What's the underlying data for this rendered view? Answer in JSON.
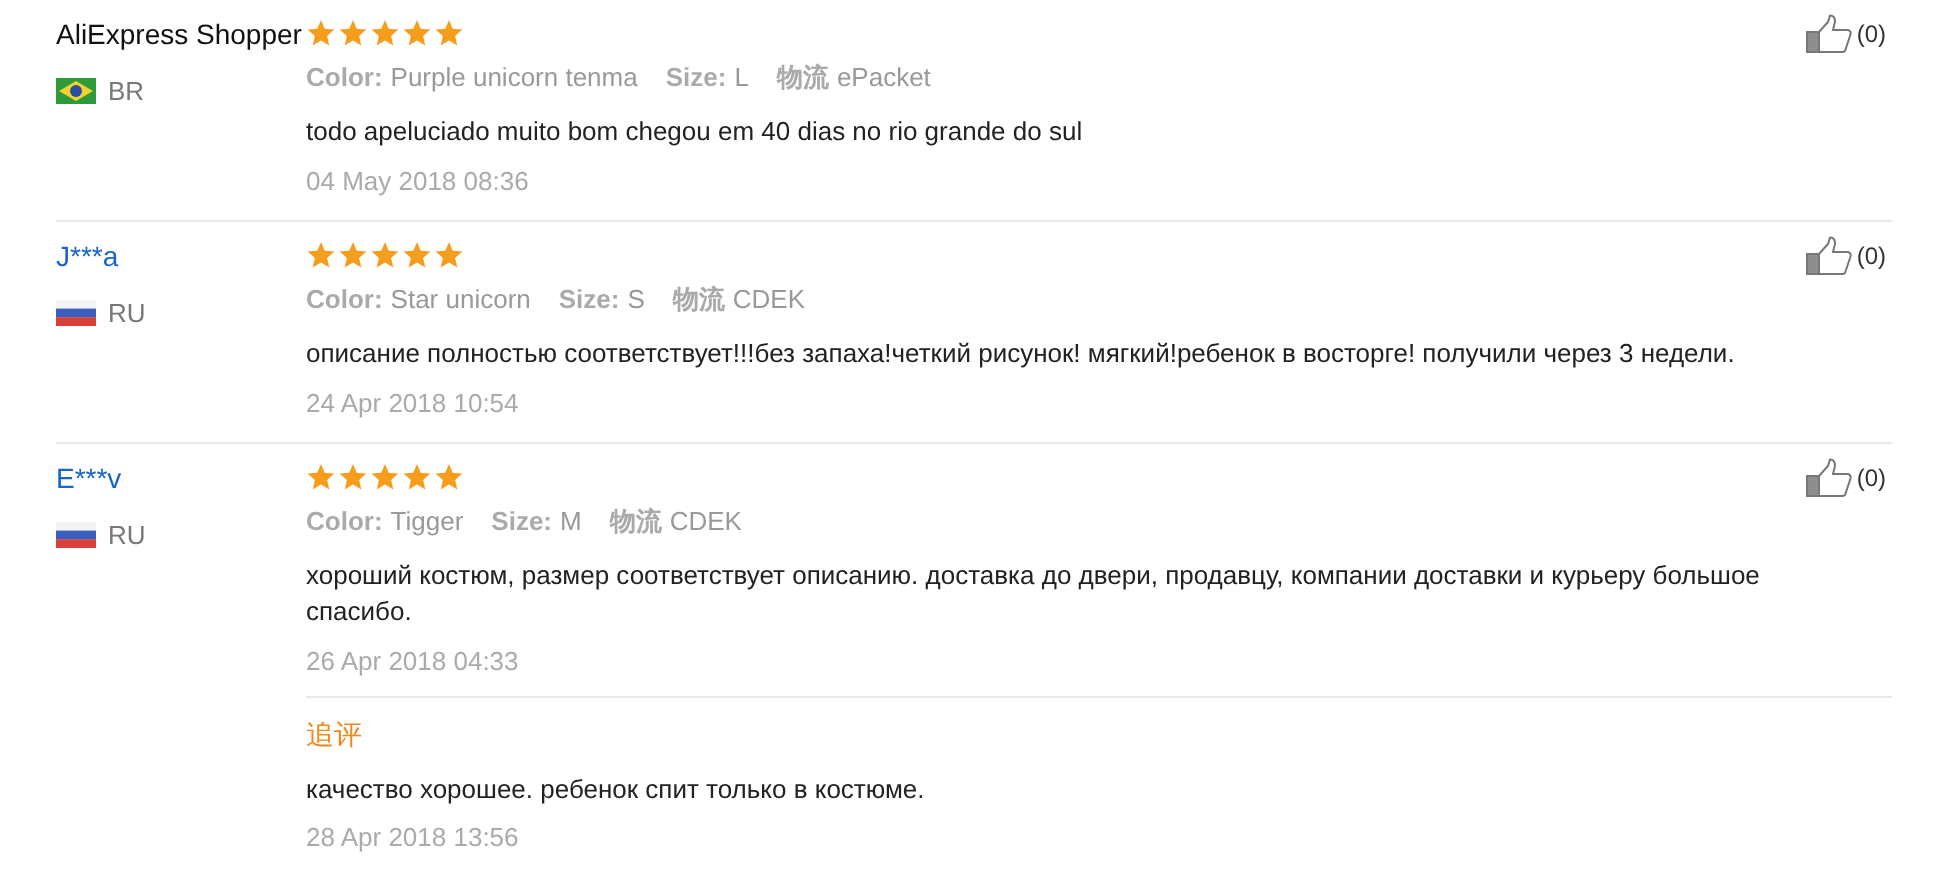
{
  "reviews": [
    {
      "name": "AliExpress Shopper",
      "linked": false,
      "country": {
        "code": "BR",
        "kind": "brazil"
      },
      "stars": 5,
      "attributes": [
        {
          "label": "Color:",
          "value": "Purple unicorn tenma"
        },
        {
          "label": "Size:",
          "value": "L"
        },
        {
          "label": "物流",
          "value": "ePacket"
        }
      ],
      "body": "todo apeluciado muito bom chegou em 40 dias no rio grande do sul",
      "date": "04 May 2018 08:36",
      "helpful": "(0)"
    },
    {
      "name": "J***a",
      "linked": true,
      "country": {
        "code": "RU",
        "kind": "russia"
      },
      "stars": 5,
      "attributes": [
        {
          "label": "Color:",
          "value": "Star unicorn"
        },
        {
          "label": "Size:",
          "value": "S"
        },
        {
          "label": "物流",
          "value": "CDEK"
        }
      ],
      "body": "описание полностью соответствует!!!без запаха!четкий рисунок! мягкий!ребенок в восторге! получили через 3 недели.",
      "date": "24 Apr 2018 10:54",
      "helpful": "(0)"
    },
    {
      "name": "E***v",
      "linked": true,
      "country": {
        "code": "RU",
        "kind": "russia"
      },
      "stars": 5,
      "attributes": [
        {
          "label": "Color:",
          "value": "Tigger"
        },
        {
          "label": "Size:",
          "value": "M"
        },
        {
          "label": "物流",
          "value": "CDEK"
        }
      ],
      "body": "хороший костюм, размер соответствует описанию. доставка до двери, продавцу, компании доставки и курьеру большое спасибо.",
      "date": "26 Apr 2018 04:33",
      "helpful": "(0)",
      "followup": {
        "label": "追评",
        "body": "качество хорошее. ребенок спит только в костюме.",
        "date": "28 Apr 2018 13:56"
      }
    }
  ]
}
